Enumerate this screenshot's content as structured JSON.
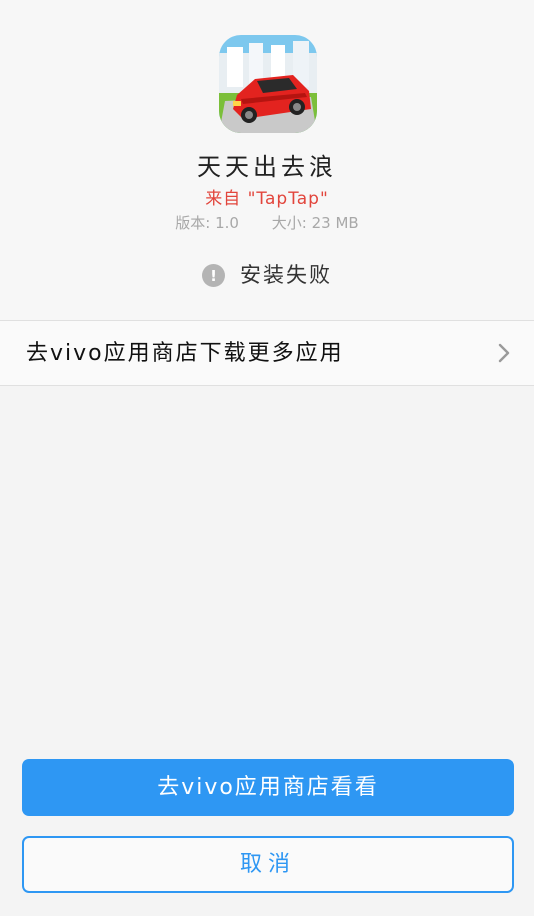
{
  "app": {
    "name": "天天出去浪",
    "source": "来自 \"TapTap\"",
    "version": "版本: 1.0",
    "size": "大小: 23 MB",
    "icon": "car-game-icon"
  },
  "status": {
    "icon": "exclamation-icon",
    "text": "安装失败"
  },
  "store_link": {
    "label": "去vivo应用商店下载更多应用",
    "icon": "chevron-right-icon"
  },
  "buttons": {
    "primary_label": "去vivo应用商店看看",
    "secondary_label": "取消"
  },
  "colors": {
    "accent": "#2e97f3",
    "source_red": "#e2453c",
    "status_gray": "#b4b4b4"
  }
}
